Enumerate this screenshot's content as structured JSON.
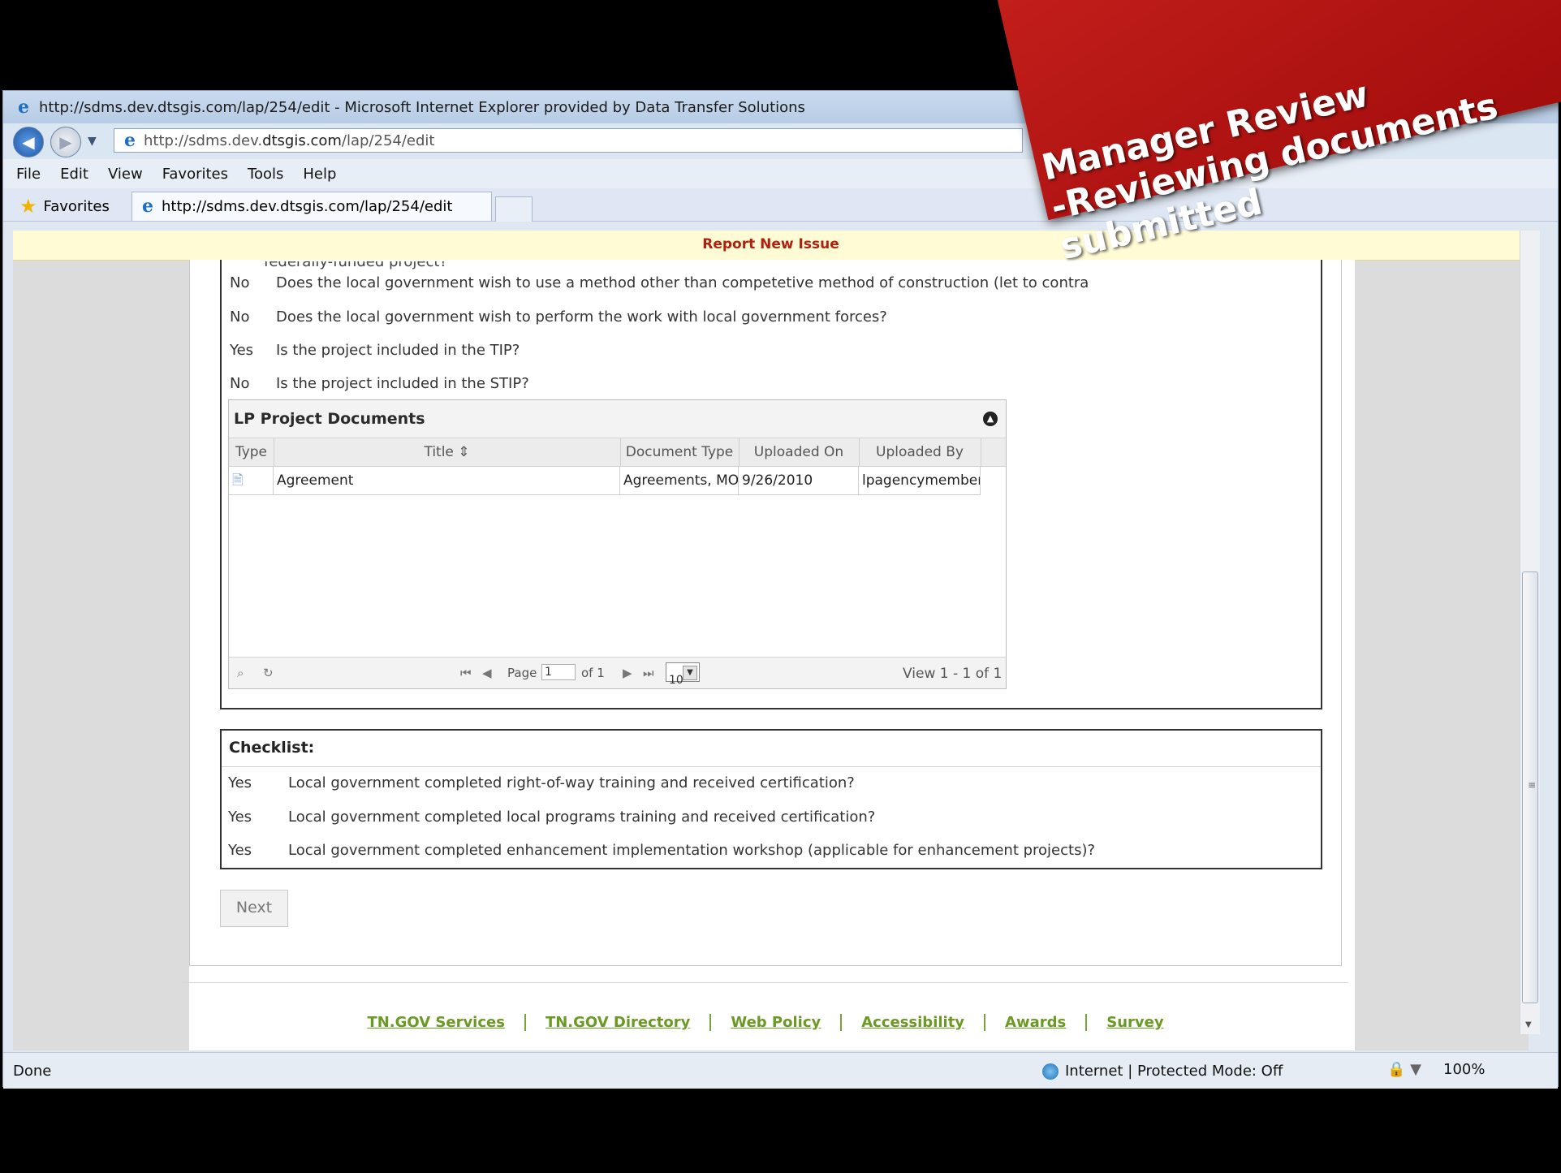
{
  "browser": {
    "title": "http://sdms.dev.dtsgis.com/lap/254/edit - Microsoft Internet Explorer provided by Data Transfer Solutions",
    "address_pre": "http://sdms.dev.",
    "address_domain": "dtsgis.com",
    "address_post": "/lap/254/edit",
    "menu": [
      "File",
      "Edit",
      "View",
      "Favorites",
      "Tools",
      "Help"
    ],
    "favorites_label": "Favorites",
    "tab_label": "http://sdms.dev.dtsgis.com/lap/254/edit"
  },
  "report_bar": "Report New Issue",
  "questions": {
    "cut_text": "federally-funded project?",
    "rows": [
      {
        "answer": "No",
        "text": "Does the local government wish to use a method other than competetive method of construction (let to contra"
      },
      {
        "answer": "No",
        "text": "Does the local government wish to perform the work with local government forces?"
      },
      {
        "answer": "Yes",
        "text": "Is the project included in the TIP?"
      },
      {
        "answer": "No",
        "text": "Is the project included in the STIP?"
      }
    ]
  },
  "documents": {
    "title": "LP Project Documents",
    "columns": [
      "Type",
      "Title ⇕",
      "Document Type",
      "Uploaded On",
      "Uploaded By"
    ],
    "row": {
      "title": "Agreement",
      "doc_type": "Agreements, MOA",
      "uploaded_on": "9/26/2010",
      "uploaded_by": "lpagencymember"
    },
    "pager": {
      "page_label": "Page",
      "page_value": "1",
      "of_label": "of 1",
      "page_size": "10",
      "view_text": "View 1 - 1 of 1"
    }
  },
  "checklist": {
    "title": "Checklist:",
    "rows": [
      {
        "answer": "Yes",
        "text": "Local government completed right-of-way training and received certification?"
      },
      {
        "answer": "Yes",
        "text": "Local government completed local programs training and received certification?"
      },
      {
        "answer": "Yes",
        "text": "Local government completed enhancement implementation workshop (applicable for enhancement projects)?"
      }
    ]
  },
  "next_label": "Next",
  "footer_links": [
    "TN.GOV Services",
    "TN.GOV Directory",
    "Web Policy",
    "Accessibility",
    "Awards",
    "Survey"
  ],
  "status": {
    "done": "Done",
    "zone": "Internet | Protected Mode: Off",
    "zoom": "100%"
  },
  "overlay": {
    "line1": "Manager Review",
    "line2": "-Reviewing documents",
    "line3": "submitted"
  },
  "colors": {
    "accent_link": "#6a9a23",
    "report_text": "#b0200e",
    "ribbon": "#c6201c"
  }
}
